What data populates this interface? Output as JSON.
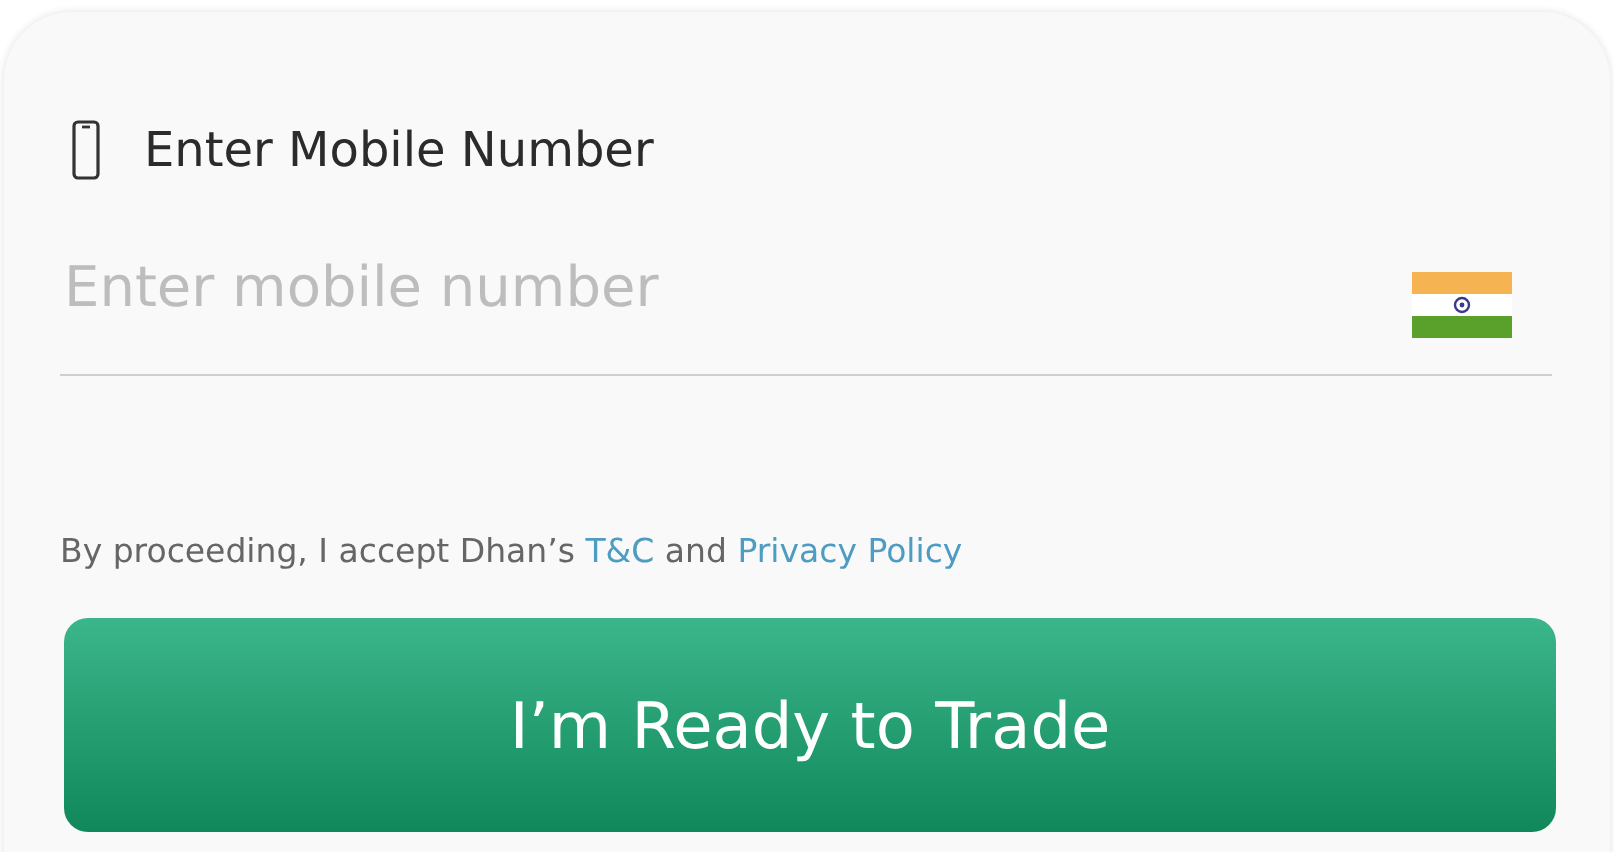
{
  "field": {
    "label": "Enter Mobile Number",
    "placeholder": "Enter mobile number"
  },
  "consent": [
    {
      "kind": "text",
      "text": "By proceeding, I accept Dhan’s "
    },
    {
      "kind": "link",
      "text": "T&C"
    },
    {
      "kind": "text",
      "text": " and "
    },
    {
      "kind": "link",
      "text": "Privacy Policy"
    }
  ],
  "button": {
    "label": "I’m Ready to Trade"
  }
}
